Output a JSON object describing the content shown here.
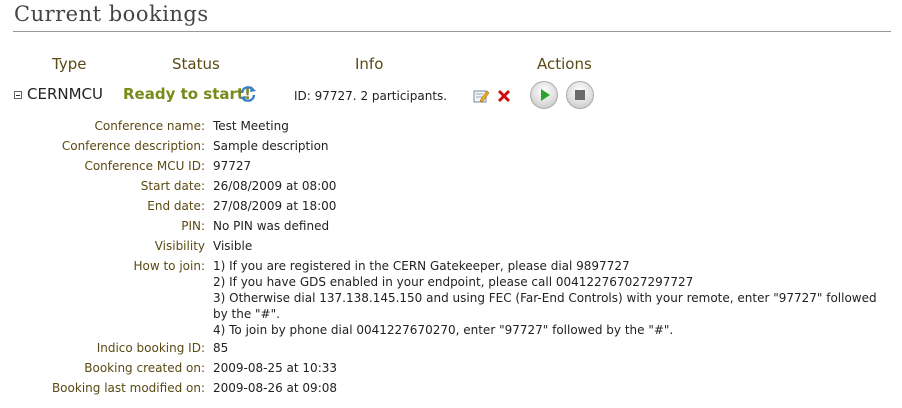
{
  "page": {
    "title": "Current bookings"
  },
  "table": {
    "headers": {
      "type": "Type",
      "status": "Status",
      "info": "Info",
      "actions": "Actions"
    },
    "booking": {
      "type": "CERNMCU",
      "status": "Ready to start!",
      "info": "ID: 97727. 2 participants."
    }
  },
  "details": [
    {
      "label": "Conference name:",
      "value": "Test Meeting"
    },
    {
      "label": "Conference description:",
      "value": "Sample description"
    },
    {
      "label": "Conference MCU ID:",
      "value": "97727"
    },
    {
      "label": "Start date:",
      "value": "26/08/2009 at 08:00"
    },
    {
      "label": "End date:",
      "value": "27/08/2009 at 18:00"
    },
    {
      "label": "PIN:",
      "value": "No PIN was defined"
    },
    {
      "label": "Visibility",
      "value": "Visible"
    }
  ],
  "how_to_join": {
    "label": "How to join:",
    "lines": [
      "1) If you are registered in the CERN Gatekeeper, please dial 9897727",
      "2) If you have GDS enabled in your endpoint, please call 004122767027297727",
      "3) Otherwise dial 137.138.145.150 and using FEC (Far-End Controls) with your remote, enter \"97727\" followed by the \"#\".",
      "4) To join by phone dial 0041227670270, enter \"97727\" followed by the \"#\"."
    ]
  },
  "details_after": [
    {
      "label": "Indico booking ID:",
      "value": "85"
    },
    {
      "label": "Booking created on:",
      "value": "2009-08-25 at 10:33"
    },
    {
      "label": "Booking last modified on:",
      "value": "2009-08-26 at 09:08"
    }
  ],
  "icons": {
    "collapse": "collapse-icon",
    "refresh": "refresh-icon",
    "edit": "edit-icon",
    "delete": "delete-icon",
    "start": "play-icon",
    "stop": "stop-icon"
  },
  "colors": {
    "status": "#7a8a1a",
    "label": "#5a4a14",
    "delete": "#d01010",
    "play": "#2aa52a"
  }
}
